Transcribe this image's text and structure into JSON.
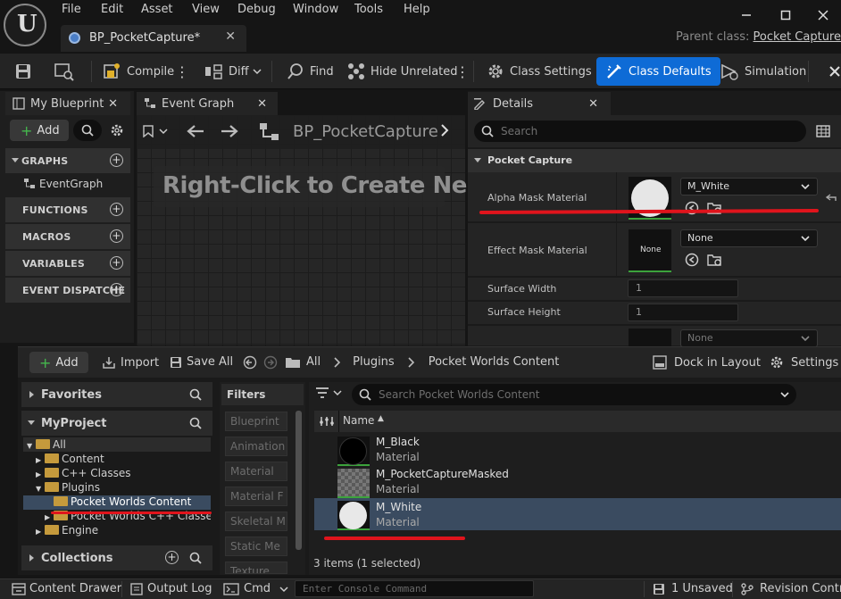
{
  "menu": [
    "File",
    "Edit",
    "Asset",
    "View",
    "Debug",
    "Window",
    "Tools",
    "Help"
  ],
  "document_tab": {
    "label": "BP_PocketCapture*"
  },
  "parent_class": {
    "prefix": "Parent class:",
    "value": "Pocket Capture"
  },
  "toolbar": {
    "compile": "Compile",
    "diff": "Diff",
    "find": "Find",
    "hide_unrelated": "Hide Unrelated",
    "class_settings": "Class Settings",
    "class_defaults": "Class Defaults",
    "simulation": "Simulation"
  },
  "my_blueprint": {
    "tab": "My Blueprint",
    "add": "Add",
    "sections": [
      "GRAPHS",
      "FUNCTIONS",
      "MACROS",
      "VARIABLES",
      "EVENT DISPATCHE"
    ],
    "graph_item": "EventGraph"
  },
  "event_graph": {
    "tab": "Event Graph",
    "breadcrumb": "BP_PocketCapture",
    "hint": "Right-Click to Create Ne"
  },
  "details": {
    "tab": "Details",
    "search_placeholder": "Search",
    "category": "Pocket Capture",
    "rows": {
      "alpha_mask": {
        "label": "Alpha Mask Material",
        "value": "M_White"
      },
      "effect_mask": {
        "label": "Effect Mask Material",
        "value": "None",
        "thumb": "None"
      },
      "surface_width": {
        "label": "Surface Width",
        "value": "1"
      },
      "surface_height": {
        "label": "Surface Height",
        "value": "1"
      },
      "extra": {
        "value": "None"
      }
    }
  },
  "content_browser": {
    "add": "Add",
    "import": "Import",
    "save_all": "Save All",
    "path": [
      "All",
      "Plugins",
      "Pocket Worlds Content"
    ],
    "dock_in_layout": "Dock in Layout",
    "settings": "Settings",
    "favorites": "Favorites",
    "project": "MyProject",
    "tree": [
      "All",
      "Content",
      "C++ Classes",
      "Plugins",
      "Pocket Worlds Content",
      "Pocket Worlds C++ Classes",
      "Engine"
    ],
    "collections": "Collections",
    "filters_label": "Filters",
    "filters": [
      "Blueprint",
      "Animation",
      "Material",
      "Material F",
      "Skeletal M",
      "Static Me",
      "Texture"
    ],
    "search_placeholder": "Search Pocket Worlds Content",
    "name_header": "Name",
    "assets": [
      {
        "name": "M_Black",
        "type": "Material"
      },
      {
        "name": "M_PocketCaptureMasked",
        "type": "Material"
      },
      {
        "name": "M_White",
        "type": "Material"
      }
    ],
    "count": "3 items (1 selected)"
  },
  "statusbar": {
    "content_drawer": "Content Drawer",
    "output_log": "Output Log",
    "cmd": "Cmd",
    "console_placeholder": "Enter Console Command",
    "unsaved": "1 Unsaved",
    "revision_control": "Revision Control"
  },
  "colors": {
    "accent": "#0e6bd6",
    "annotation": "#e0141c",
    "selection": "#3a4b60"
  }
}
